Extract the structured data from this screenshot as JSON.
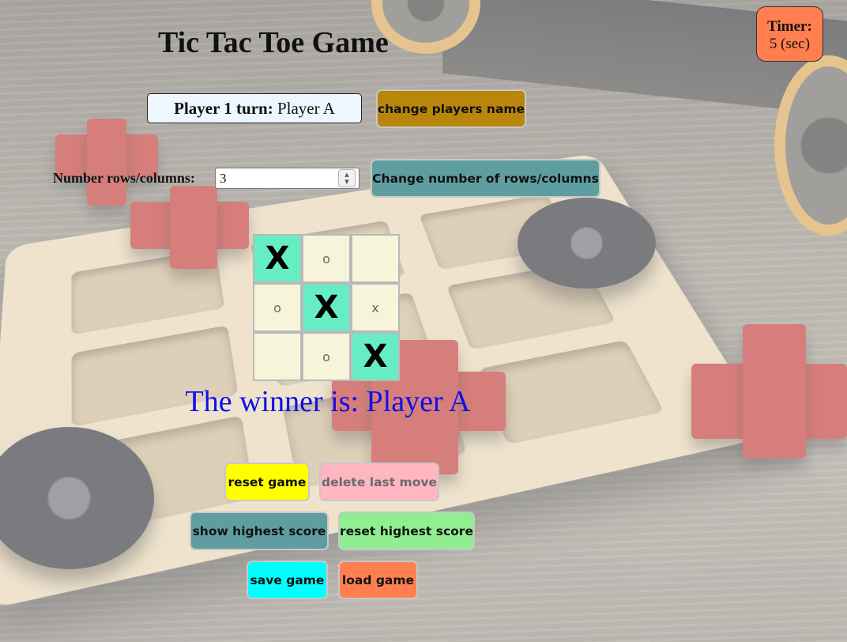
{
  "title": "Tic Tac Toe Game",
  "timer": {
    "label": "Timer:",
    "value": "5 (sec)"
  },
  "turn": {
    "label": "Player 1 turn:",
    "player": "Player A"
  },
  "buttons": {
    "change_names": "change players name",
    "change_size": "Change number of rows/columns",
    "reset_game": "reset game",
    "delete_last_move": "delete last move",
    "show_highest_score": "show highest score",
    "reset_highest_score": "reset highest score",
    "save_game": "save game",
    "load_game": "load game"
  },
  "size": {
    "label": "Number rows/columns:",
    "value": "3"
  },
  "board": [
    [
      "X",
      "O",
      ""
    ],
    [
      "O",
      "X",
      "X"
    ],
    [
      "",
      "O",
      "X"
    ]
  ],
  "winning_cells": [
    [
      0,
      0
    ],
    [
      1,
      1
    ],
    [
      2,
      2
    ]
  ],
  "winner_text": "The winner is: Player A",
  "colors": {
    "timer_bg": "#ff7f50",
    "change_names_bg": "#b8860b",
    "change_size_bg": "#5f9ea0",
    "reset_game_bg": "#ffff00",
    "delete_last_move_bg": "#ffb6c1",
    "show_highest_score_bg": "#5f9ea0",
    "reset_highest_score_bg": "#90ee90",
    "save_game_bg": "#00ffff",
    "load_game_bg": "#ff7f50",
    "winning_cell_bg": "#66edc4",
    "cell_bg": "#f6f5da",
    "winner_text": "#1010e6"
  },
  "icons": {
    "spinner": "number-spinner-arrows-icon"
  }
}
